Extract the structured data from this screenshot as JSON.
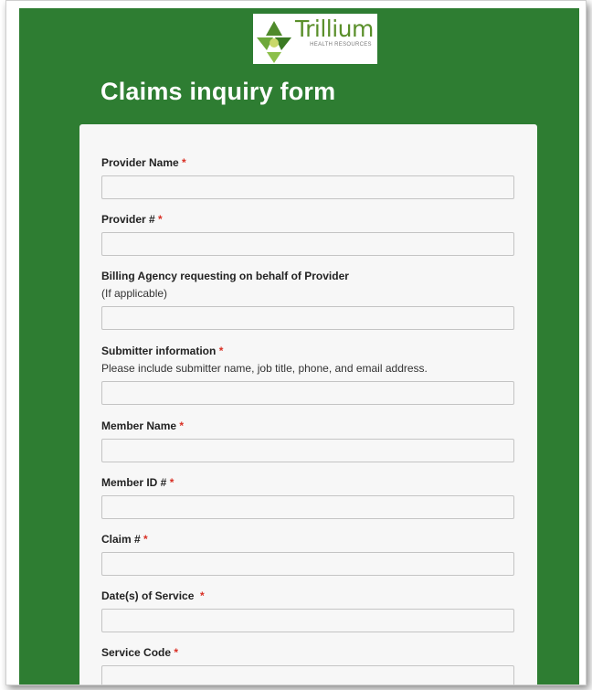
{
  "logo": {
    "name": "Trillium",
    "subtitle": "HEALTH RESOURCES"
  },
  "form": {
    "title": "Claims inquiry form",
    "required_marker": "*",
    "fields": [
      {
        "label": "Provider Name",
        "required": true,
        "help": "",
        "value": ""
      },
      {
        "label": "Provider #",
        "required": true,
        "help": "",
        "value": ""
      },
      {
        "label": "Billing Agency requesting on behalf of Provider",
        "required": false,
        "help": "(If applicable)",
        "value": ""
      },
      {
        "label": "Submitter information",
        "required": true,
        "help": "Please include submitter name, job title, phone, and email address.",
        "value": ""
      },
      {
        "label": "Member Name",
        "required": true,
        "help": "",
        "value": ""
      },
      {
        "label": "Member ID #",
        "required": true,
        "help": "",
        "value": ""
      },
      {
        "label": "Claim #",
        "required": true,
        "help": "",
        "value": ""
      },
      {
        "label": "Date(s) of Service",
        "required": true,
        "help": "",
        "value": ""
      },
      {
        "label": "Service Code",
        "required": true,
        "help": "",
        "value": ""
      }
    ]
  },
  "colors": {
    "header_green": "#2e7d32",
    "card_background": "#f7f7f7",
    "required_red": "#d93025",
    "logo_green": "#5a8f2a"
  }
}
